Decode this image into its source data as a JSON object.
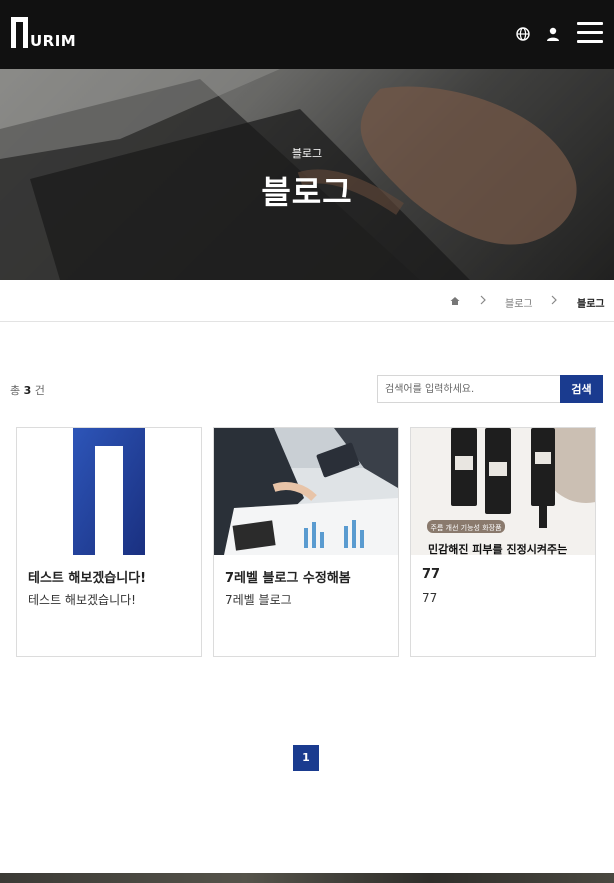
{
  "header": {
    "logo_text": "URIM",
    "icons": [
      "globe-icon",
      "user-icon",
      "hamburger-menu-icon"
    ]
  },
  "hero": {
    "subtitle": "블로그",
    "title": "블로그"
  },
  "breadcrumb": {
    "items": [
      "블로그",
      "블로그"
    ]
  },
  "list": {
    "count_prefix": "총",
    "count": "3",
    "count_suffix": "건"
  },
  "search": {
    "placeholder": "검색어를 입력하세요.",
    "button_label": "검색"
  },
  "posts": [
    {
      "title": "테스트 해보겠습니다!",
      "desc": "테스트 해보겠습니다!"
    },
    {
      "title": "7레벨 블로그 수정해봄",
      "desc": "7레벨 블로그"
    },
    {
      "title": "77",
      "desc": "77",
      "thumb_badge": "주름 개선 기능성 화장품",
      "thumb_caption": "민감해진 피부를 진정시켜주는"
    }
  ],
  "pagination": {
    "current": "1"
  },
  "colors": {
    "header_bg": "#111111",
    "brand_blue": "#1a3b8f"
  }
}
